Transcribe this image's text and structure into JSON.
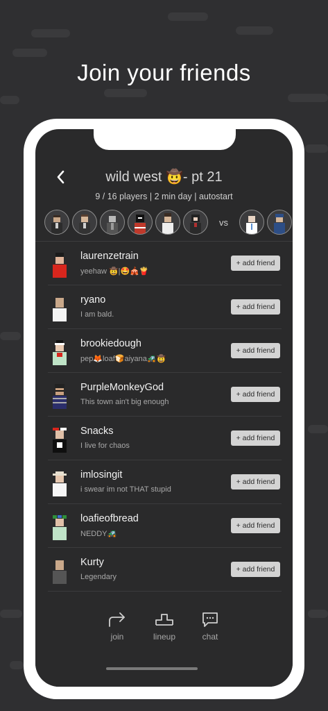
{
  "headline": "Join your friends",
  "game": {
    "title": "wild west 🤠- pt 21",
    "subtitle": "9 / 16 players | 2 min day | autostart",
    "vs_label": "vs"
  },
  "players": [
    {
      "name": "laurenzetrain",
      "status": "yeehaw 🤠|🤩🎪🍟",
      "button": "+ add friend"
    },
    {
      "name": "ryano",
      "status": "I am bald.",
      "button": "+ add friend"
    },
    {
      "name": "brookiedough",
      "status": "pep🦊loaf🍞aiyana🚜🤠",
      "button": "+ add friend"
    },
    {
      "name": "PurpleMonkeyGod",
      "status": "This town ain't big enough",
      "button": "+ add friend"
    },
    {
      "name": "Snacks",
      "status": "I live for chaos",
      "button": "+ add friend"
    },
    {
      "name": "imlosingit",
      "status": "i swear im not THAT stupid",
      "button": "+ add friend"
    },
    {
      "name": "loafieofbread",
      "status": "NEDDY🚜",
      "button": "+ add friend"
    },
    {
      "name": "Kurty",
      "status": "Legendary",
      "button": "+ add friend"
    }
  ],
  "nav": {
    "join": "join",
    "lineup": "lineup",
    "chat": "chat"
  },
  "colors": {
    "background": "#2f2f31",
    "screen": "#2a2a2b",
    "button": "#d3d3d3"
  }
}
